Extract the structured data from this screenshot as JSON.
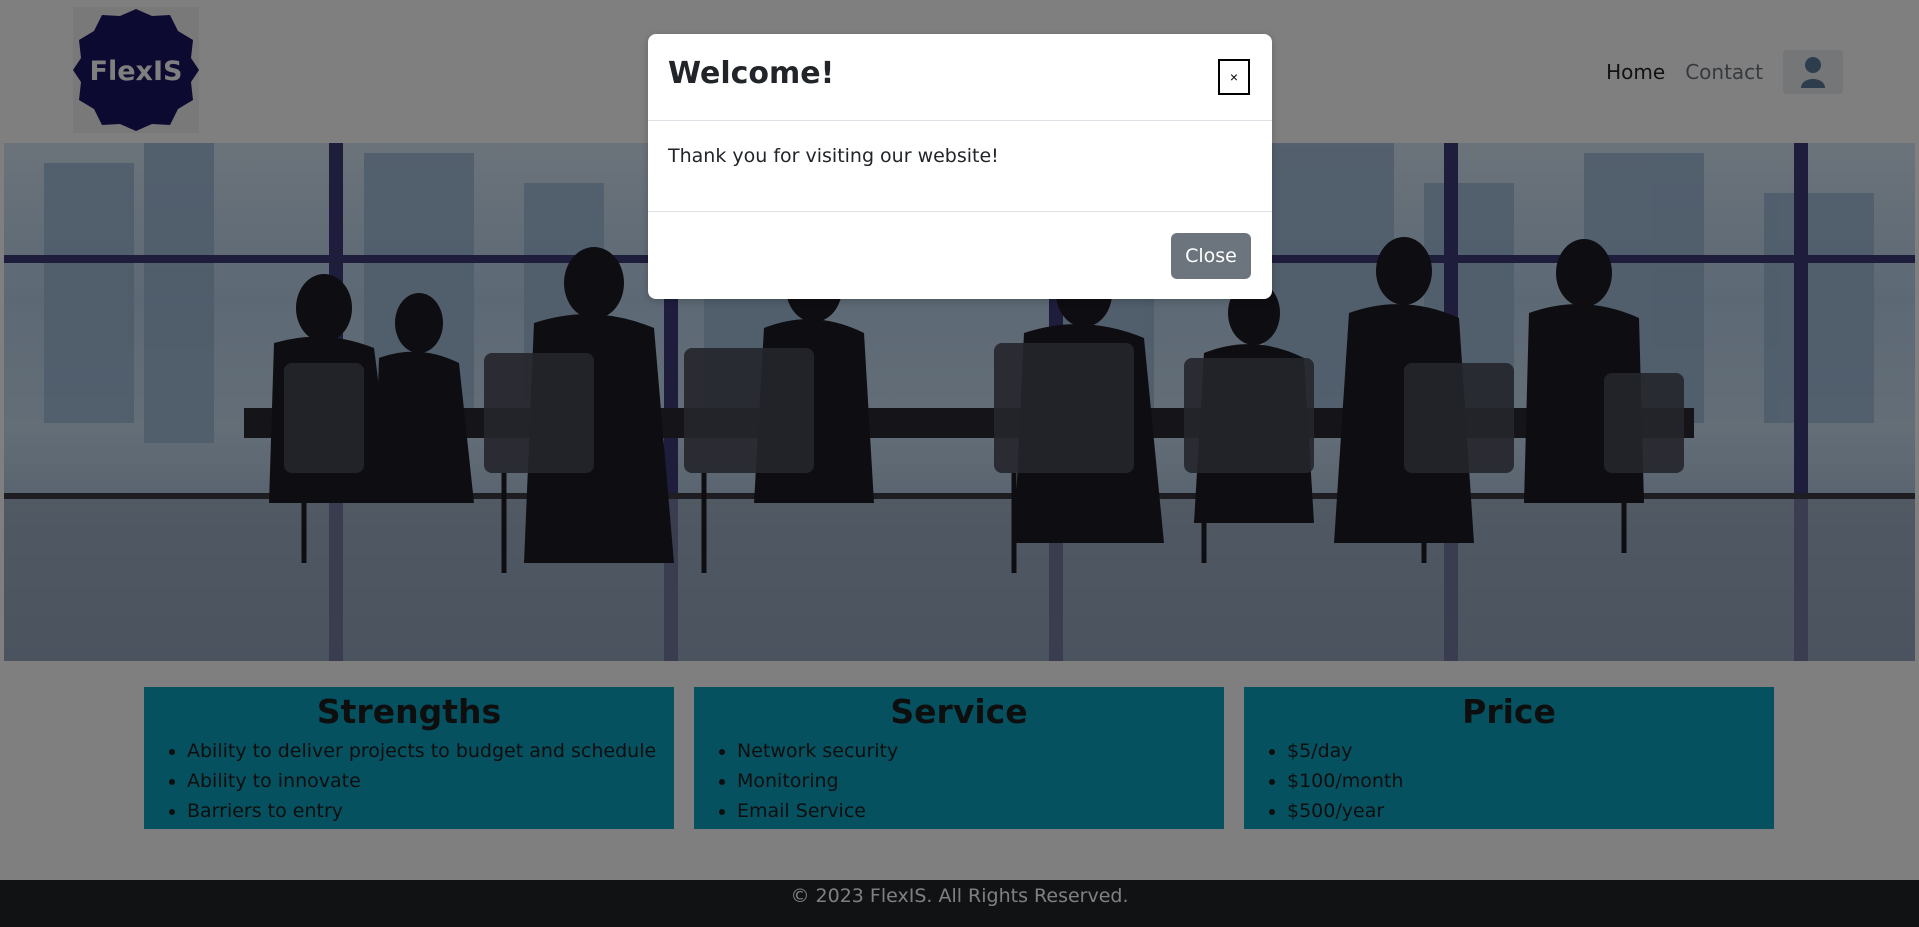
{
  "header": {
    "logo_text": "FlexIS",
    "nav": {
      "home": "Home",
      "contact": "Contact"
    }
  },
  "cards": [
    {
      "title": "Strengths",
      "items": [
        "Ability to deliver projects to budget and schedule",
        "Ability to innovate",
        "Barriers to entry"
      ]
    },
    {
      "title": "Service",
      "items": [
        "Network security",
        "Monitoring",
        "Email Service"
      ]
    },
    {
      "title": "Price",
      "items": [
        "$5/day",
        "$100/month",
        "$500/year"
      ]
    }
  ],
  "footer": {
    "text": "© 2023 FlexIS. All Rights Reserved."
  },
  "modal": {
    "title": "Welcome!",
    "close_x": "×",
    "body": "Thank you for visiting our website!",
    "close_label": "Close"
  },
  "colors": {
    "card_bg": "#0aa2c0",
    "footer_bg": "#212529",
    "close_button_bg": "#6c757d",
    "logo_bg": "#1b1464"
  }
}
